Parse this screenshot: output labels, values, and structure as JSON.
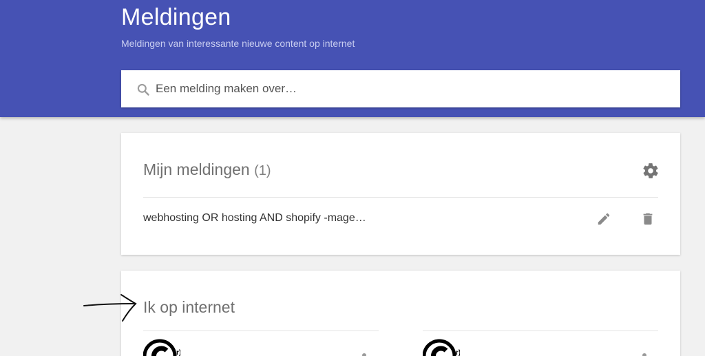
{
  "header": {
    "title": "Meldingen",
    "subtitle": "Meldingen van interessante nieuwe content op internet",
    "background_color": "#4652b4"
  },
  "search": {
    "placeholder": "Een melding maken over…",
    "icon": "search-icon"
  },
  "my_alerts": {
    "title": "Mijn meldingen",
    "count": "(1)",
    "settings_icon": "gear-icon",
    "items": [
      {
        "query": "webhosting OR hosting AND shopify -mage…",
        "edit_icon": "pencil-icon",
        "delete_icon": "trash-icon"
      }
    ]
  },
  "me_on_internet": {
    "title": "Ik op internet"
  },
  "annotation": {
    "icon": "hand-drawn-arrow-icon"
  }
}
